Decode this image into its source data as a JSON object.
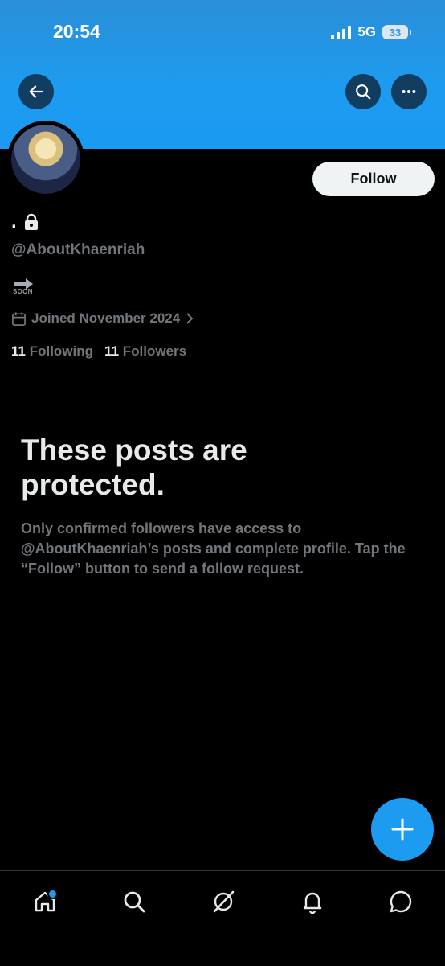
{
  "status_bar": {
    "time": "20:54",
    "network": "5G",
    "battery": "33"
  },
  "profile": {
    "display_name": ".",
    "handle": "@AboutKhaenriah",
    "bio_text": "SOON",
    "joined": "Joined November 2024",
    "following_count": "11",
    "following_label": "Following",
    "followers_count": "11",
    "followers_label": "Followers",
    "follow_button": "Follow"
  },
  "protected_notice": {
    "title": "These posts are protected.",
    "body": "Only confirmed followers have access to @AboutKhaenriah’s posts and complete profile. Tap the “Follow” button to send a follow request."
  },
  "icons": {
    "back": "arrow-left-icon",
    "search": "search-icon",
    "more": "more-icon",
    "lock": "lock-icon",
    "calendar": "calendar-icon",
    "compose": "plus-icon",
    "nav": [
      "home-icon",
      "search-icon",
      "grok-icon",
      "notifications-icon",
      "messages-icon"
    ]
  },
  "colors": {
    "accent": "#1d9bf0",
    "background": "#000000",
    "muted_text": "#71767b"
  }
}
